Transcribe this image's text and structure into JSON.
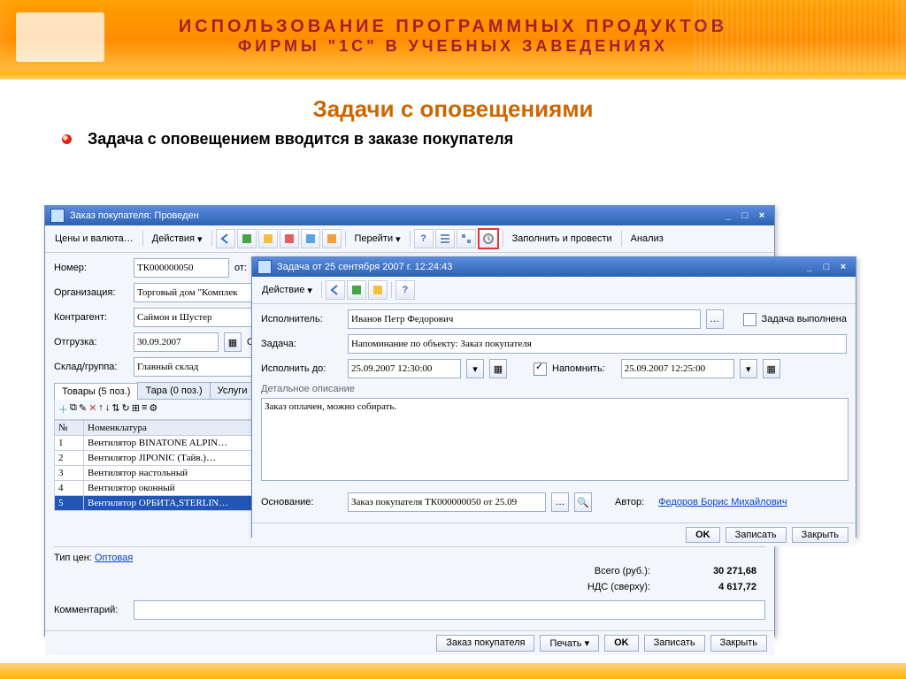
{
  "banner": {
    "line1": "ИСПОЛЬЗОВАНИЕ ПРОГРАММНЫХ ПРОДУКТОВ",
    "line2": "ФИРМЫ \"1С\" В УЧЕБНЫХ ЗАВЕДЕНИЯХ"
  },
  "slide_title": "Задачи с оповещениями",
  "bullet": "Задача с оповещением вводится в заказе покупателя",
  "order_win": {
    "title": "Заказ покупателя: Проведен",
    "toolbar": {
      "prices": "Цены и валюта…",
      "actions": "Действия",
      "go": "Перейти",
      "fill": "Заполнить и провести",
      "analysis": "Анализ"
    },
    "fields": {
      "number_lbl": "Номер:",
      "number": "ТК000000050",
      "from_lbl": "от:",
      "org_lbl": "Организация:",
      "org": "Торговый дом \"Комплек",
      "contr_lbl": "Контрагент:",
      "contr": "Саймон и Шустер",
      "ship_lbl": "Отгрузка:",
      "ship": "30.09.2007",
      "o_lbl": "О",
      "store_lbl": "Склад/группа:",
      "store": "Главный склад"
    },
    "tabs": {
      "goods": "Товары (5 поз.)",
      "tara": "Тара (0 поз.)",
      "usl": "Услуги"
    },
    "grid": {
      "h1": "№",
      "h2": "Номенклатура",
      "rows": [
        {
          "n": "1",
          "name": "Вентилятор BINATONE ALPIN…"
        },
        {
          "n": "2",
          "name": "Вентилятор JIPONIC (Тайв.)…"
        },
        {
          "n": "3",
          "name": "Вентилятор настольный"
        },
        {
          "n": "4",
          "name": "Вентилятор оконный"
        },
        {
          "n": "5",
          "name": "Вентилятор ОРБИТА,STERLIN…"
        }
      ]
    },
    "price_type_lbl": "Тип цен: ",
    "price_type": "Оптовая",
    "totals": {
      "total_lbl": "Всего (руб.):",
      "total": "30 271,68",
      "nds_lbl": "НДС (сверху):",
      "nds": "4 617,72"
    },
    "comment_lbl": "Комментарий:",
    "btns": {
      "order": "Заказ покупателя",
      "print": "Печать",
      "ok": "OK",
      "save": "Записать",
      "close": "Закрыть"
    }
  },
  "task_win": {
    "title": "Задача от 25 сентября 2007 г. 12:24:43",
    "toolbar": {
      "action": "Действие"
    },
    "fields": {
      "exec_lbl": "Исполнитель:",
      "exec": "Иванов Петр Федорович",
      "done_lbl": "Задача выполнена",
      "task_lbl": "Задача:",
      "task": "Напоминание по объекту: Заказ покупателя",
      "due_lbl": "Исполнить до:",
      "due": "25.09.2007 12:30:00",
      "remind_lbl": "Напомнить:",
      "remind": "25.09.2007 12:25:00",
      "detail_lbl": "Детальное описание",
      "detail": "Заказ оплачен, можно собирать.",
      "basis_lbl": "Основание:",
      "basis": "Заказ покупателя ТК000000050 от 25.09",
      "author_lbl": "Автор:",
      "author": "Федоров Борис Михайлович"
    },
    "btns": {
      "ok": "OK",
      "save": "Записать",
      "close": "Закрыть"
    }
  }
}
